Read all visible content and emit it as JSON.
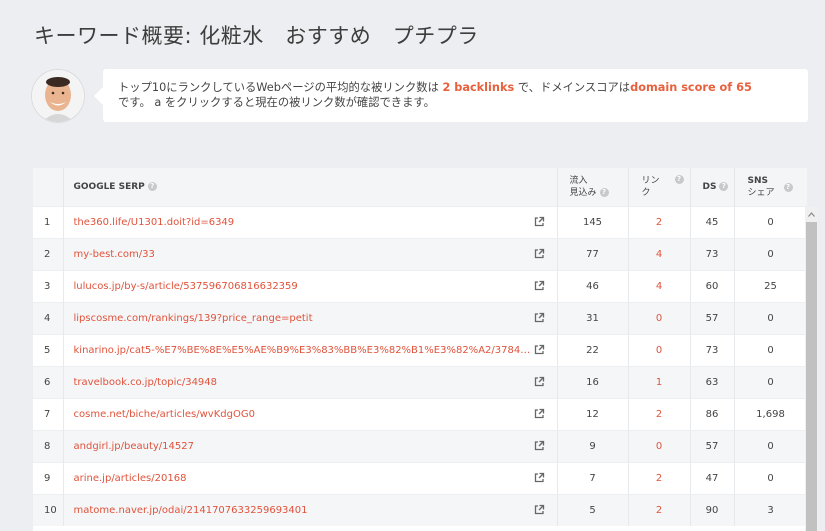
{
  "page": {
    "title": "キーワード概要: 化粧水　おすすめ　プチプラ"
  },
  "tip": {
    "part1": "トップ10にランクしているWebページの平均的な被リンク数は ",
    "backlinks": "2 backlinks",
    "part2": " で、ドメインスコアは",
    "domain_score": "domain score of 65",
    "part3": "です。 a をクリックすると現在の被リンク数が確認できます。"
  },
  "table": {
    "headers": {
      "serp": "GOOGLE SERP",
      "traffic_line1": "流入",
      "traffic_line2": "見込み",
      "links_line1": "リン",
      "links_line2": "ク",
      "ds": "DS",
      "sns_line1": "SNS",
      "sns_line2": "シェア"
    },
    "rows": [
      {
        "rank": "1",
        "url": "the360.life/U1301.doit?id=6349",
        "traffic": "145",
        "links": "2",
        "ds": "45",
        "sns": "0"
      },
      {
        "rank": "2",
        "url": "my-best.com/33",
        "traffic": "77",
        "links": "4",
        "ds": "73",
        "sns": "0"
      },
      {
        "rank": "3",
        "url": "lulucos.jp/by-s/article/537596706816632359",
        "traffic": "46",
        "links": "4",
        "ds": "60",
        "sns": "25"
      },
      {
        "rank": "4",
        "url": "lipscosme.com/rankings/139?price_range=petit",
        "traffic": "31",
        "links": "0",
        "ds": "57",
        "sns": "0"
      },
      {
        "rank": "5",
        "url": "kinarino.jp/cat5-%E7%BE%8E%E5%AE%B9%E3%83%BB%E3%82%B1%E3%82%A2/37846-%E3%81%8A...",
        "traffic": "22",
        "links": "0",
        "ds": "73",
        "sns": "0"
      },
      {
        "rank": "6",
        "url": "travelbook.co.jp/topic/34948",
        "traffic": "16",
        "links": "1",
        "ds": "63",
        "sns": "0"
      },
      {
        "rank": "7",
        "url": "cosme.net/biche/articles/wvKdgOG0",
        "traffic": "12",
        "links": "2",
        "ds": "86",
        "sns": "1,698"
      },
      {
        "rank": "8",
        "url": "andgirl.jp/beauty/14527",
        "traffic": "9",
        "links": "0",
        "ds": "57",
        "sns": "0"
      },
      {
        "rank": "9",
        "url": "arine.jp/articles/20168",
        "traffic": "7",
        "links": "2",
        "ds": "47",
        "sns": "0"
      },
      {
        "rank": "10",
        "url": "matome.naver.jp/odai/2141707633259693401",
        "traffic": "5",
        "links": "2",
        "ds": "90",
        "sns": "3"
      }
    ]
  },
  "colors": {
    "accent": "#e0533b",
    "background": "#eceef1"
  },
  "icons": {
    "help": "help-circle-icon",
    "external": "external-link-icon"
  }
}
